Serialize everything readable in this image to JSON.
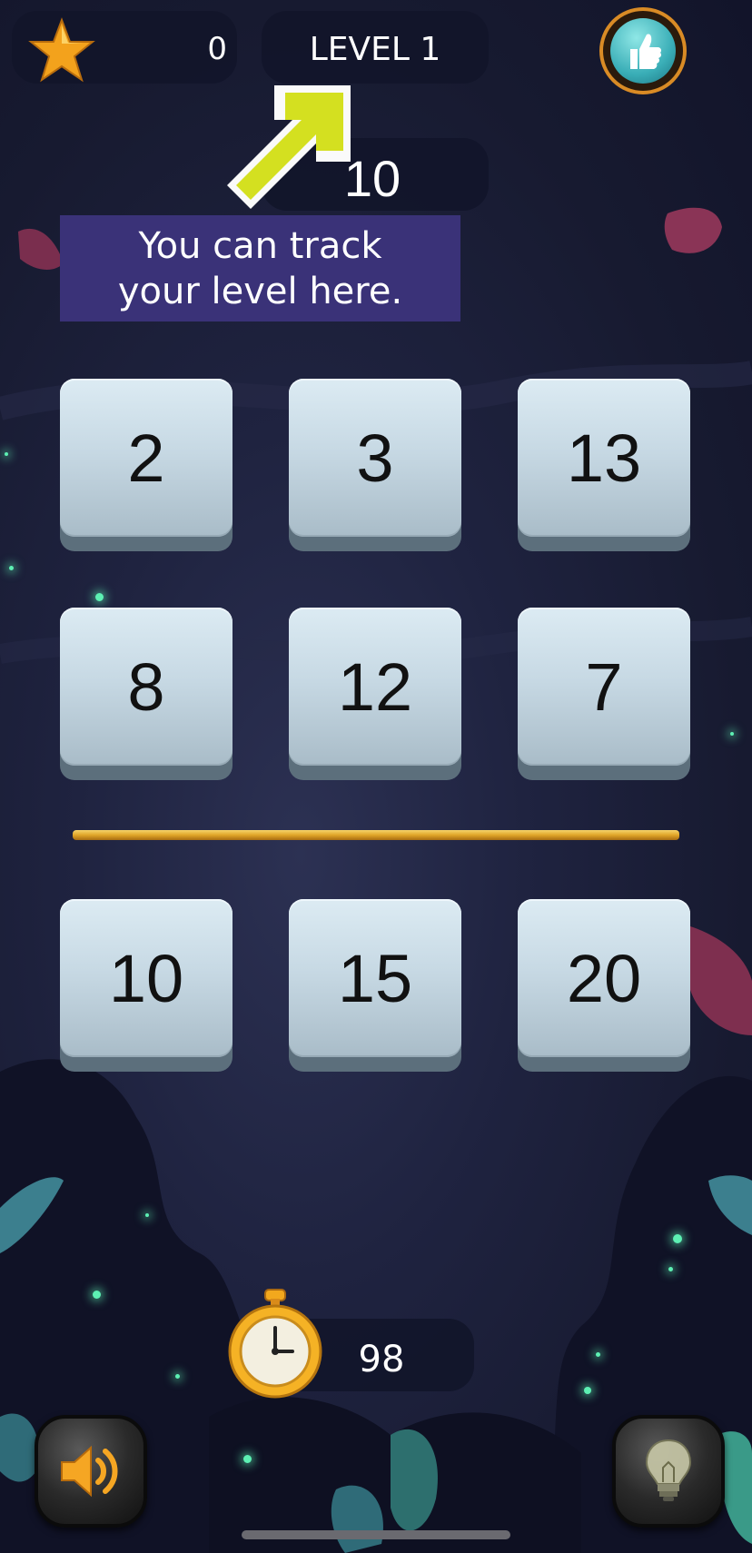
{
  "hud": {
    "score": "0",
    "level_label": "LEVEL 1",
    "target": "10",
    "timer": "98"
  },
  "tutorial": {
    "line1": "You can track",
    "line2": "your level here."
  },
  "tiles": {
    "row1": [
      "2",
      "3",
      "13"
    ],
    "row2": [
      "8",
      "12",
      "7"
    ],
    "answers": [
      "10",
      "15",
      "20"
    ]
  },
  "icons": {
    "score": "star-icon",
    "like": "thumbs-up-icon",
    "timer": "stopwatch-icon",
    "sound": "speaker-icon",
    "hint": "lightbulb-icon",
    "pointer": "arrow-icon"
  },
  "colors": {
    "tooltip_bg": "#3a3278",
    "arrow": "#d4e020",
    "divider": "#e0a528",
    "tile_face": "#c7d9e4"
  }
}
